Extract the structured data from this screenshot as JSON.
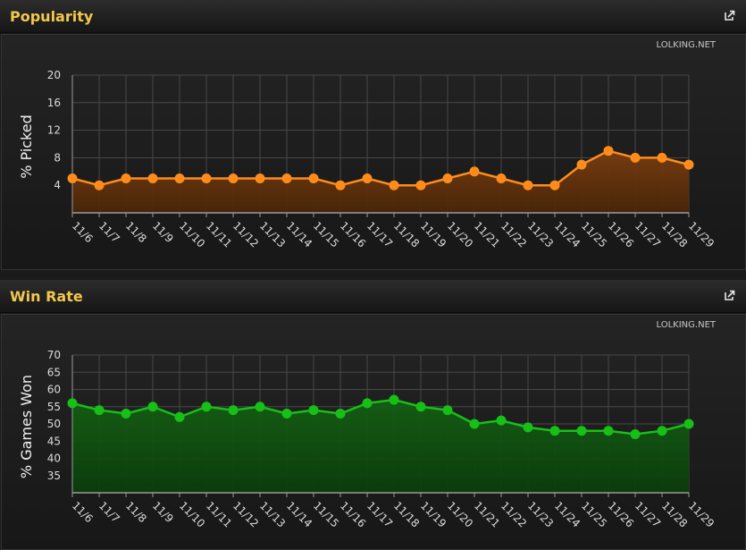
{
  "panels": [
    {
      "title": "Popularity",
      "credit": "LOLKING.NET"
    },
    {
      "title": "Win Rate",
      "credit": "LOLKING.NET"
    }
  ],
  "colors": {
    "popularity_line": "#ff8c1a",
    "winrate_line": "#16c016",
    "title": "#f3c84a"
  },
  "chart_data": [
    {
      "type": "area",
      "title": "Popularity",
      "ylabel": "% Picked",
      "xlabel": "",
      "categories": [
        "11/6",
        "11/7",
        "11/8",
        "11/9",
        "11/10",
        "11/11",
        "11/12",
        "11/13",
        "11/14",
        "11/15",
        "11/16",
        "11/17",
        "11/18",
        "11/19",
        "11/20",
        "11/21",
        "11/22",
        "11/23",
        "11/24",
        "11/25",
        "11/26",
        "11/27",
        "11/28",
        "11/29"
      ],
      "values": [
        5,
        4,
        5,
        5,
        5,
        5,
        5,
        5,
        5,
        5,
        4,
        5,
        4,
        4,
        5,
        6,
        5,
        4,
        4,
        7,
        9,
        8,
        8,
        7
      ],
      "ylim": [
        0,
        20
      ],
      "yticks": [
        4,
        8,
        12,
        16,
        20
      ],
      "grid": true,
      "legend": "none"
    },
    {
      "type": "area",
      "title": "Win Rate",
      "ylabel": "% Games Won",
      "xlabel": "",
      "categories": [
        "11/6",
        "11/7",
        "11/8",
        "11/9",
        "11/10",
        "11/11",
        "11/12",
        "11/13",
        "11/14",
        "11/15",
        "11/16",
        "11/17",
        "11/18",
        "11/19",
        "11/20",
        "11/21",
        "11/22",
        "11/23",
        "11/24",
        "11/25",
        "11/26",
        "11/27",
        "11/28",
        "11/29"
      ],
      "values": [
        56,
        54,
        53,
        55,
        52,
        55,
        54,
        55,
        53,
        54,
        53,
        56,
        57,
        55,
        54,
        50,
        51,
        49,
        48,
        48,
        48,
        47,
        48,
        50
      ],
      "ylim": [
        30,
        70
      ],
      "yticks": [
        35,
        40,
        45,
        50,
        55,
        60,
        65,
        70
      ],
      "grid": true,
      "legend": "none"
    }
  ]
}
